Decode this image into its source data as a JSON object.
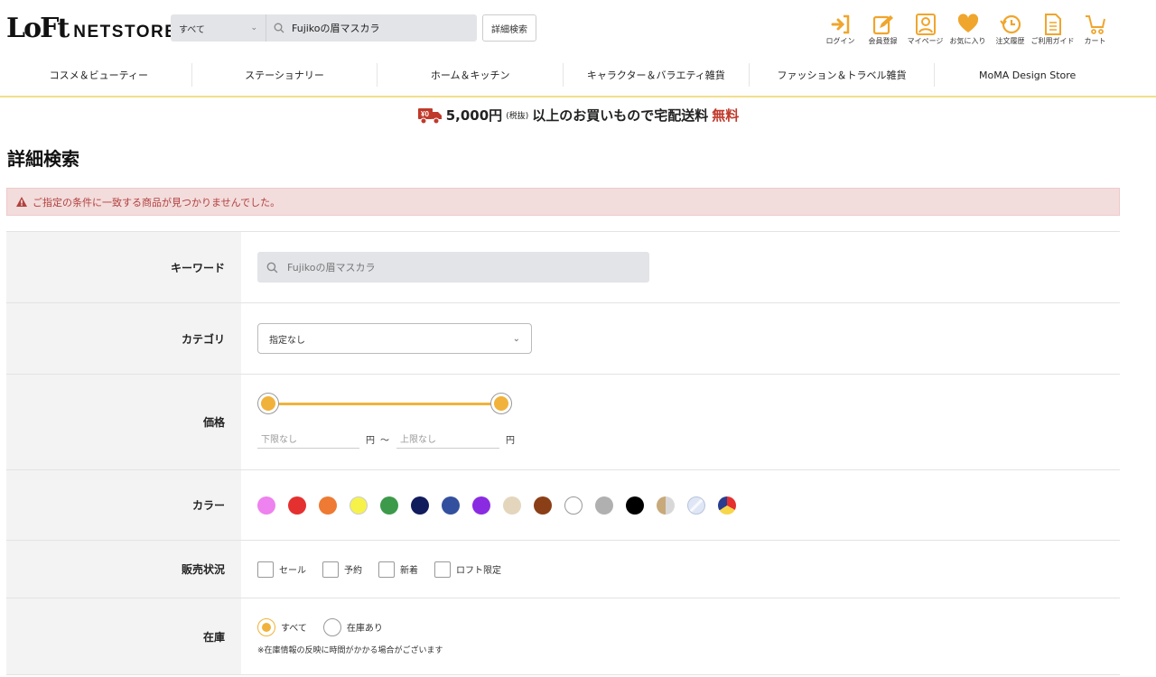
{
  "header": {
    "logo_mark": "LoFt",
    "logo_text": "NETSTORE",
    "search_scope": "すべて",
    "search_query": "Fujikoの眉マスカラ",
    "detail_search_label": "詳細検索",
    "icons": [
      {
        "icon": "login-icon",
        "label": "ログイン"
      },
      {
        "icon": "register-icon",
        "label": "会員登録"
      },
      {
        "icon": "mypage-icon",
        "label": "マイページ"
      },
      {
        "icon": "heart-icon",
        "label": "お気に入り"
      },
      {
        "icon": "history-icon",
        "label": "注文履歴"
      },
      {
        "icon": "guide-icon",
        "label": "ご利用ガイド"
      },
      {
        "icon": "cart-icon",
        "label": "カート"
      }
    ]
  },
  "nav": {
    "items": [
      "コスメ＆ビューティー",
      "ステーショナリー",
      "ホーム＆キッチン",
      "キャラクター＆バラエティ雑貨",
      "ファッション＆トラベル雑貨",
      "MoMA Design Store"
    ]
  },
  "banner": {
    "amount": "5,000円",
    "tax": "(税抜)",
    "text": "以上のお買いもので宅配送料",
    "free": "無料"
  },
  "page": {
    "title": "詳細検索",
    "alert": "ご指定の条件に一致する商品が見つかりませんでした。"
  },
  "form": {
    "keyword_label": "キーワード",
    "keyword_value": "Fujikoの眉マスカラ",
    "category_label": "カテゴリ",
    "category_value": "指定なし",
    "price_label": "価格",
    "price_min_placeholder": "下限なし",
    "price_max_placeholder": "上限なし",
    "yen": "円",
    "tilde": "〜",
    "color_label": "カラー",
    "colors": [
      "#ee82ee",
      "#e53030",
      "#ee7a33",
      "#f7f24a",
      "#3c9a4a",
      "#101c5c",
      "#33509e",
      "#8a2be2",
      "#e4d6bd",
      "#8b3f16",
      "#ffffff",
      "#b0b0b0",
      "#000000",
      "gold-silver",
      "clear",
      "multi"
    ],
    "status_label": "販売状況",
    "status_options": [
      "セール",
      "予約",
      "新着",
      "ロフト限定"
    ],
    "stock_label": "在庫",
    "stock_options": [
      "すべて",
      "在庫あり"
    ],
    "stock_selected": "すべて",
    "stock_note": "※在庫情報の反映に時間がかかる場合がございます"
  }
}
